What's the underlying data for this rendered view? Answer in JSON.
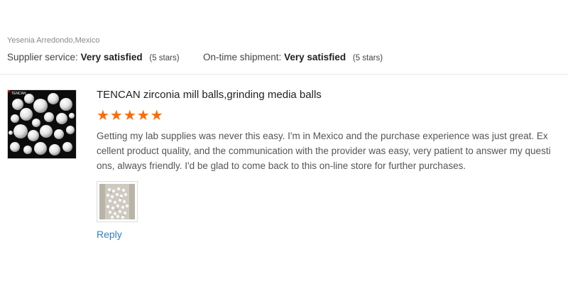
{
  "reviewer": {
    "name_location": "Yesenia Arredondo,Mexico"
  },
  "ratings": {
    "supplier_service": {
      "label": "Supplier service:",
      "value": "Very satisfied",
      "stars_text": "(5 stars)"
    },
    "shipment": {
      "label": "On-time shipment:",
      "value": "Very satisfied",
      "stars_text": "(5 stars)"
    }
  },
  "product": {
    "title": "TENCAN zirconia mill balls,grinding media balls",
    "rating": 5,
    "stars_glyphs": "★★★★★",
    "star_color": "#ff6a00",
    "thumb_logo": "TENCAN"
  },
  "review": {
    "text": "Getting my lab supplies was never this easy. I'm in Mexico and the purchase experience was just great. Excellent product quality, and the communication with the provider was easy, very patient to answer my questions, always friendly. I'd be glad to come back to this on-line store for further purchases."
  },
  "actions": {
    "reply_label": "Reply",
    "link_color": "#2e7fc9"
  }
}
